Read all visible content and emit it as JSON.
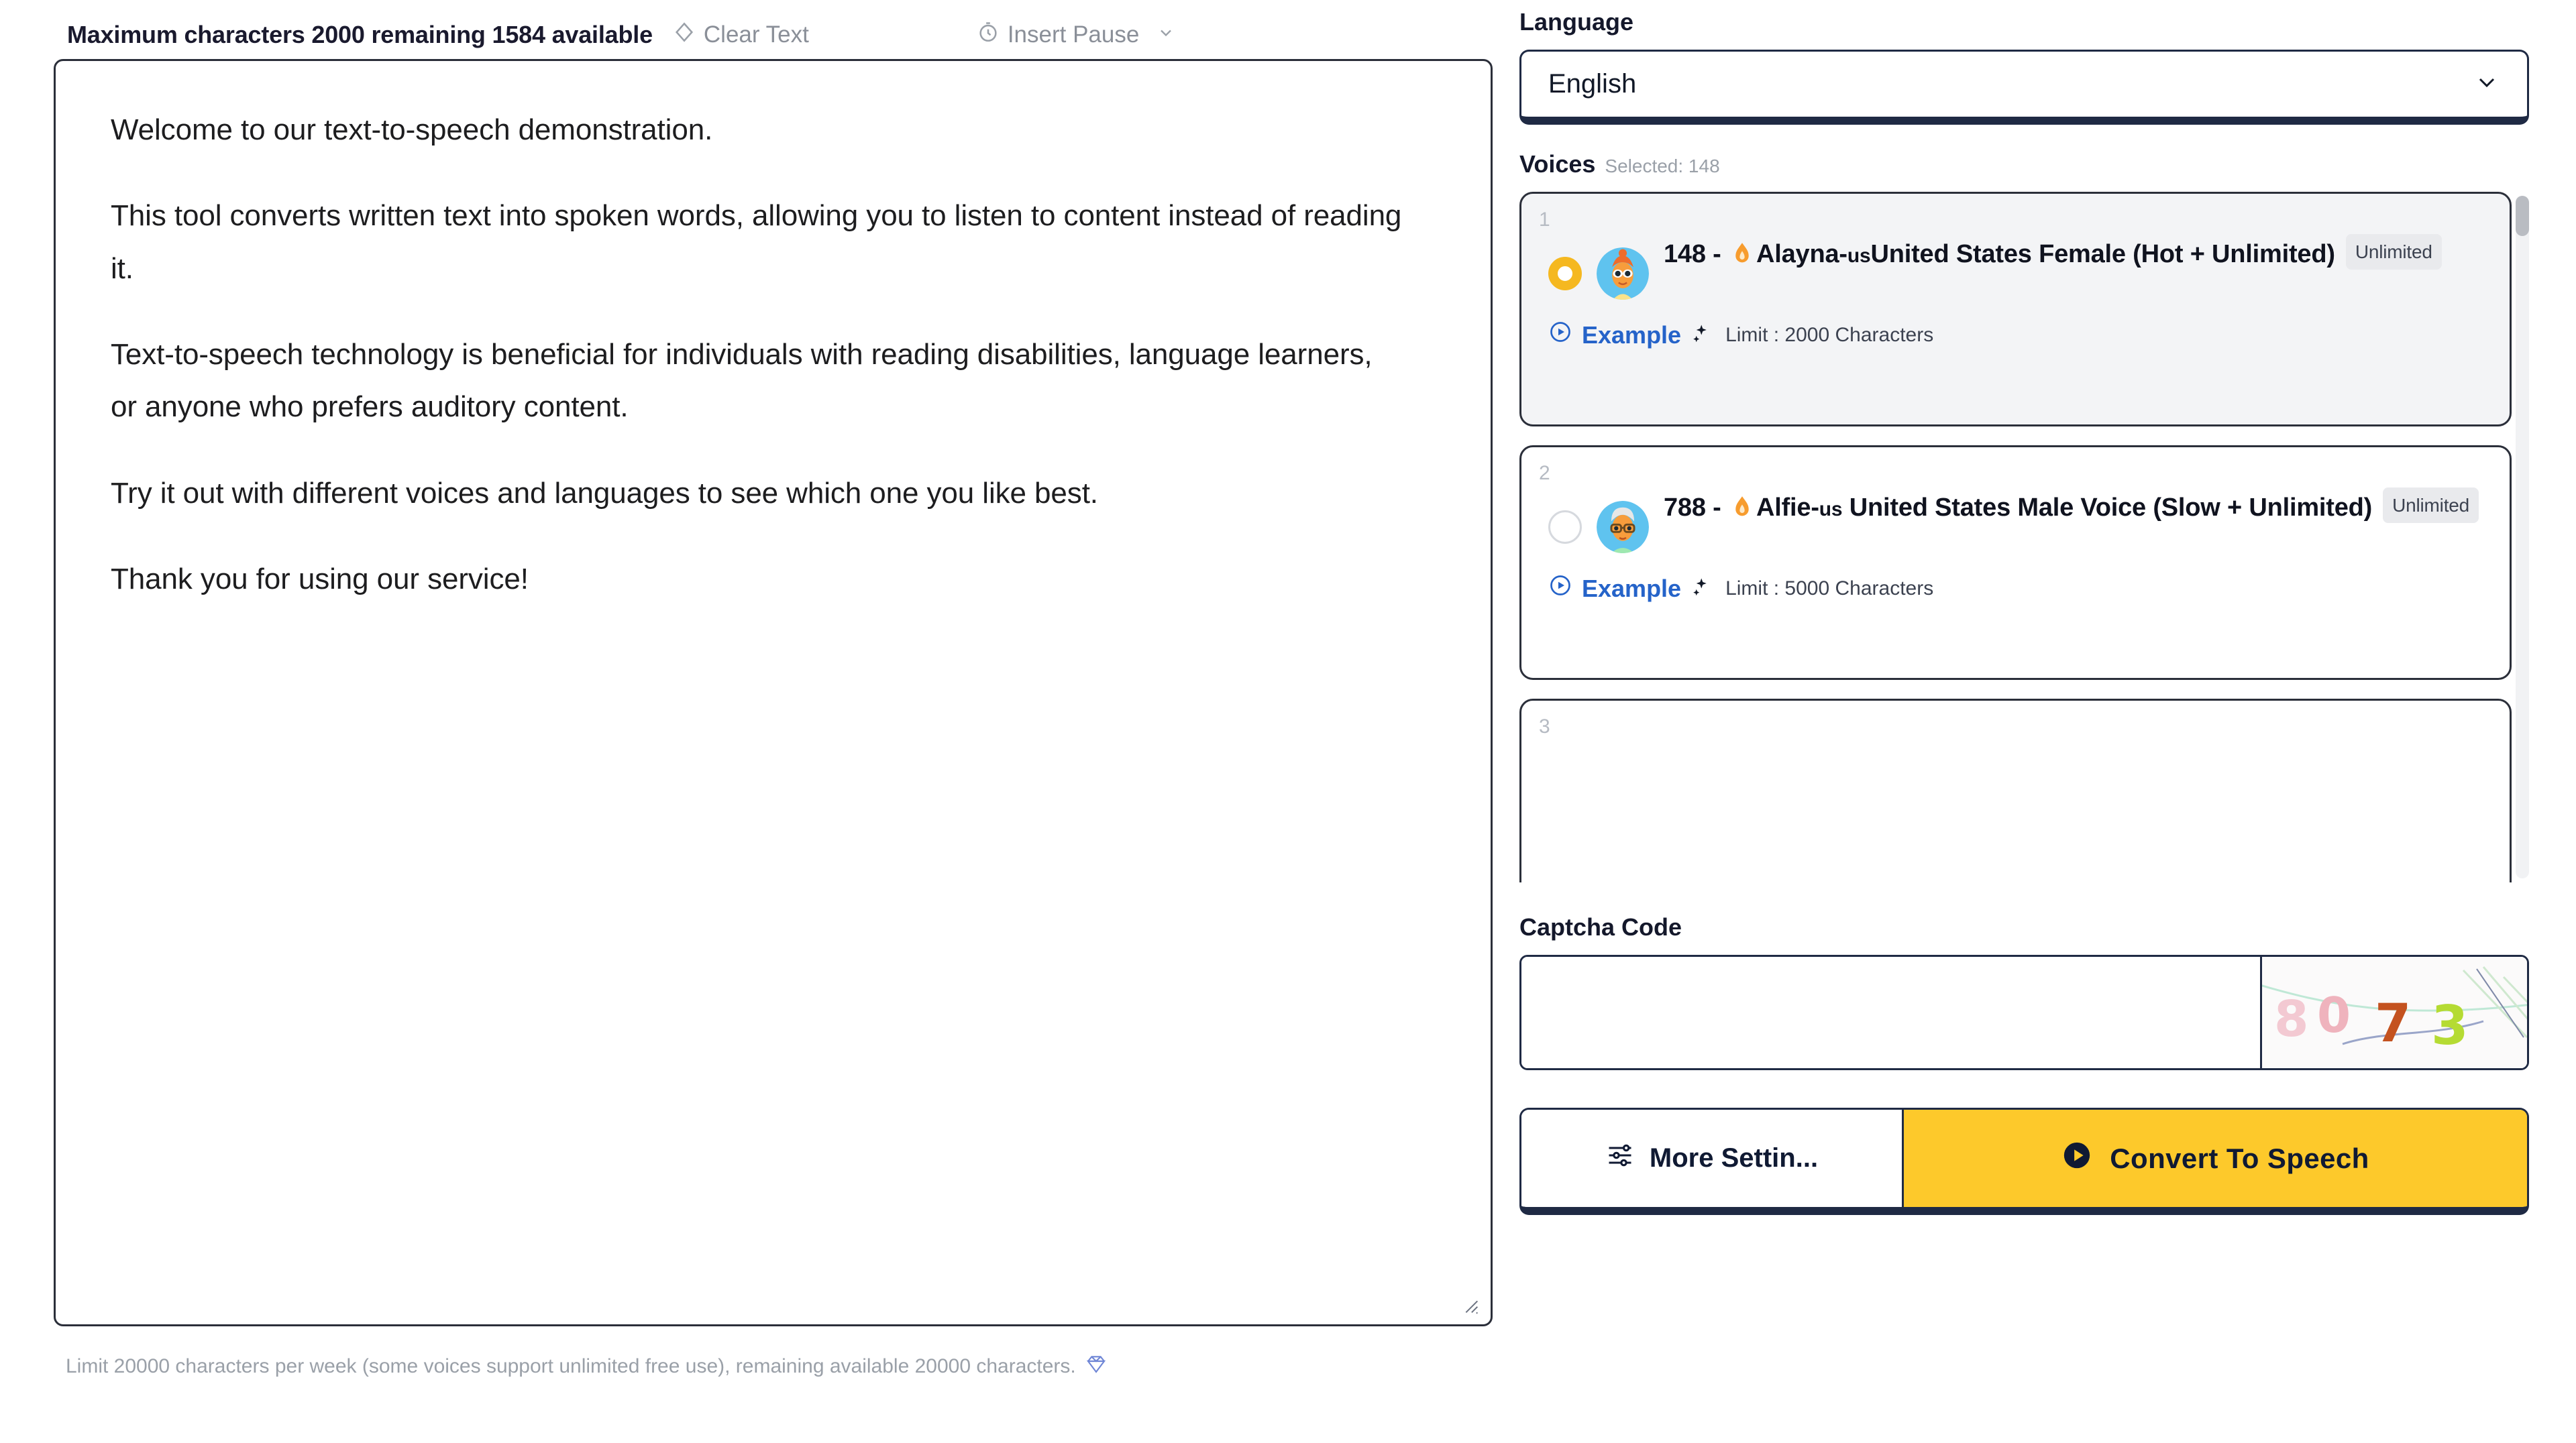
{
  "editor": {
    "char_counter": "Maximum characters 2000 remaining 1584 available",
    "max_characters": 2000,
    "remaining": 1584,
    "clear_text_label": "Clear Text",
    "insert_pause_label": "Insert Pause",
    "textarea_value": "Welcome to our text-to-speech demonstration.\n\nThis tool converts written text into spoken words, allowing you to listen to content instead of reading it.\n\nText-to-speech technology is beneficial for individuals with reading disabilities, language learners, or anyone who prefers auditory content.\n\nTry it out with different voices and languages to see which one you like best.\n\nThank you for using our service!",
    "paragraphs": [
      "Welcome to our text-to-speech demonstration.",
      "This tool converts written text into spoken words, allowing you to listen to content instead of reading it.",
      "Text-to-speech technology is beneficial for individuals with reading disabilities, language learners, or anyone who prefers auditory content.",
      "Try it out with different voices and languages to see which one you like best.",
      "Thank you for using our service!"
    ],
    "footer_note": "Limit 20000 characters per week (some voices support unlimited free use), remaining available 20000 characters."
  },
  "language": {
    "label": "Language",
    "selected": "English"
  },
  "voices": {
    "label": "Voices",
    "selected_note": "Selected: 148",
    "items": [
      {
        "index": "1",
        "selected": true,
        "id": "148",
        "prefix": "148 - ",
        "name": "Alayna-",
        "region_code": "us",
        "description": "United States Female (Hot + Unlimited)",
        "badge": "Unlimited",
        "example_label": "Example",
        "limit_text": "Limit : 2000 Characters"
      },
      {
        "index": "2",
        "selected": false,
        "id": "788",
        "prefix": "788 - ",
        "name": "Alfie-",
        "region_code": "us",
        "description": " United States Male Voice (Slow + Unlimited)",
        "badge": "Unlimited",
        "example_label": "Example",
        "limit_text": "Limit : 5000 Characters"
      },
      {
        "index": "3",
        "selected": false,
        "id": "",
        "prefix": "",
        "name": "",
        "region_code": "",
        "description": "",
        "badge": "",
        "example_label": "",
        "limit_text": ""
      }
    ]
  },
  "captcha": {
    "label": "Captcha Code",
    "input_value": "",
    "placeholder": "",
    "code_text": "8073"
  },
  "actions": {
    "more_settings_label": "More Settin...",
    "convert_label": "Convert To Speech"
  },
  "colors": {
    "accent_yellow": "#fdc92b",
    "navy": "#1f2a44",
    "link_blue": "#2563c9",
    "radio_gold": "#f5b820",
    "muted": "#9aa0a8"
  }
}
